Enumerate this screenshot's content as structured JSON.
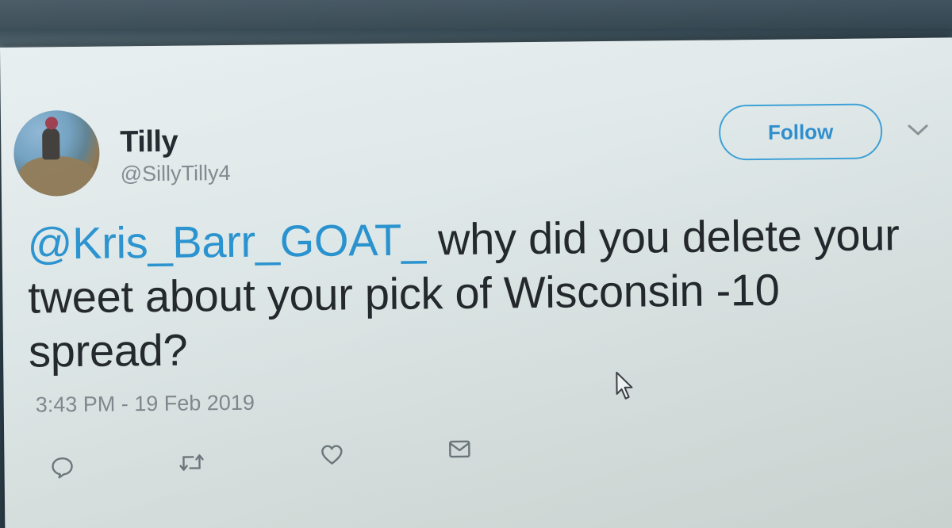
{
  "tweet": {
    "display_name": "Tilly",
    "handle": "@SillyTilly4",
    "follow_label": "Follow",
    "mention": "@Kris_Barr_GOAT_",
    "text": " why did you delete your tweet about your pick of Wisconsin -10 spread?",
    "timestamp": "3:43 PM - 19 Feb 2019"
  },
  "icons": {
    "caret": "chevron-down-icon",
    "reply": "reply-icon",
    "retweet": "retweet-icon",
    "like": "heart-icon",
    "dm": "envelope-icon",
    "cursor": "mouse-pointer-icon"
  },
  "colors": {
    "link": "#2a93cf",
    "follow_border": "#3da2d8",
    "text": "#24292d",
    "secondary": "#7f898e"
  }
}
